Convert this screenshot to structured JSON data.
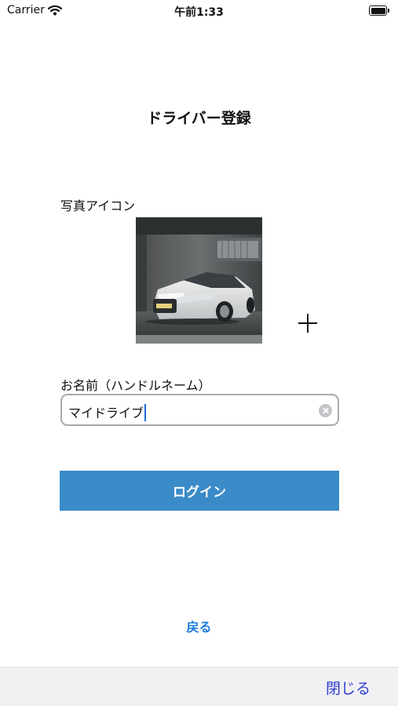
{
  "status_bar": {
    "carrier": "Carrier",
    "time": "午前1:33"
  },
  "page": {
    "title": "ドライバー登録"
  },
  "photo_section": {
    "label": "写真アイコン",
    "add_icon": "plus-icon"
  },
  "name_section": {
    "label": "お名前（ハンドルネーム）",
    "value": "マイドライブ"
  },
  "actions": {
    "login_label": "ログイン",
    "back_label": "戻る"
  },
  "toolbar": {
    "close_label": "閉じる"
  },
  "colors": {
    "primary_button": "#3a8bc8",
    "link": "#1a7be0",
    "toolbar_button": "#2f3bd1",
    "toolbar_background": "#f1f1f4"
  }
}
